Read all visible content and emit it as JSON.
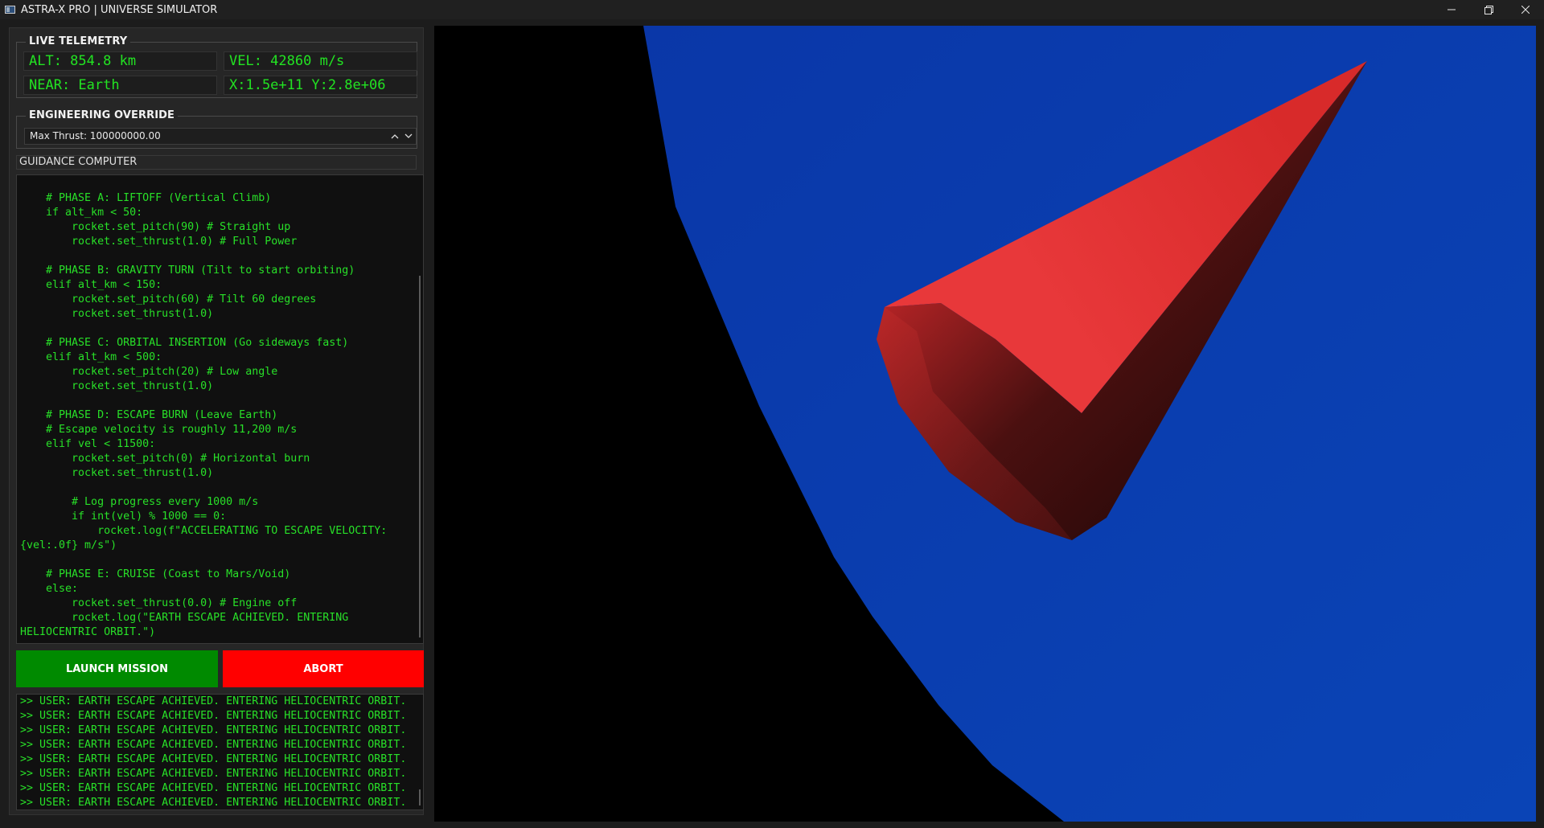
{
  "window": {
    "title": "ASTRA-X PRO | UNIVERSE SIMULATOR",
    "minimize_icon": "minimize-icon",
    "restore_icon": "restore-icon",
    "close_icon": "close-icon"
  },
  "telemetry": {
    "title": "LIVE TELEMETRY",
    "alt": "ALT: 854.8 km",
    "vel": "VEL: 42860 m/s",
    "near": "NEAR: Earth",
    "pos": "X:1.5e+11 Y:2.8e+06",
    "value_color": "#22e322"
  },
  "engineering": {
    "title": "ENGINEERING OVERRIDE",
    "max_thrust": "Max Thrust: 100000000.00"
  },
  "guidance": {
    "label": "GUIDANCE COMPUTER",
    "code": "    # PHASE A: LIFTOFF (Vertical Climb)\n    if alt_km < 50:\n        rocket.set_pitch(90) # Straight up\n        rocket.set_thrust(1.0) # Full Power\n\n    # PHASE B: GRAVITY TURN (Tilt to start orbiting)\n    elif alt_km < 150:\n        rocket.set_pitch(60) # Tilt 60 degrees\n        rocket.set_thrust(1.0)\n\n    # PHASE C: ORBITAL INSERTION (Go sideways fast)\n    elif alt_km < 500:\n        rocket.set_pitch(20) # Low angle\n        rocket.set_thrust(1.0)\n\n    # PHASE D: ESCAPE BURN (Leave Earth)\n    # Escape velocity is roughly 11,200 m/s\n    elif vel < 11500:\n        rocket.set_pitch(0) # Horizontal burn\n        rocket.set_thrust(1.0)\n\n        # Log progress every 1000 m/s\n        if int(vel) % 1000 == 0:\n            rocket.log(f\"ACCELERATING TO ESCAPE VELOCITY:\n{vel:.0f} m/s\")\n\n    # PHASE E: CRUISE (Coast to Mars/Void)\n    else:\n        rocket.set_thrust(0.0) # Engine off\n        rocket.log(\"EARTH ESCAPE ACHIEVED. ENTERING\nHELIOCENTRIC ORBIT.\")"
  },
  "buttons": {
    "launch": "LAUNCH MISSION",
    "abort": "ABORT",
    "launch_color": "#008a00",
    "abort_color": "#ff0000"
  },
  "log": {
    "lines": [
      ">> USER: EARTH ESCAPE ACHIEVED. ENTERING HELIOCENTRIC ORBIT.",
      ">> USER: EARTH ESCAPE ACHIEVED. ENTERING HELIOCENTRIC ORBIT.",
      ">> USER: EARTH ESCAPE ACHIEVED. ENTERING HELIOCENTRIC ORBIT.",
      ">> USER: EARTH ESCAPE ACHIEVED. ENTERING HELIOCENTRIC ORBIT.",
      ">> USER: EARTH ESCAPE ACHIEVED. ENTERING HELIOCENTRIC ORBIT.",
      ">> USER: EARTH ESCAPE ACHIEVED. ENTERING HELIOCENTRIC ORBIT.",
      ">> USER: EARTH ESCAPE ACHIEVED. ENTERING HELIOCENTRIC ORBIT.",
      ">> USER: EARTH ESCAPE ACHIEVED. ENTERING HELIOCENTRIC ORBIT."
    ]
  },
  "scene": {
    "planet_color": "#0a3fae",
    "rocket_color": "#e02a2a",
    "space_color": "#000000"
  }
}
